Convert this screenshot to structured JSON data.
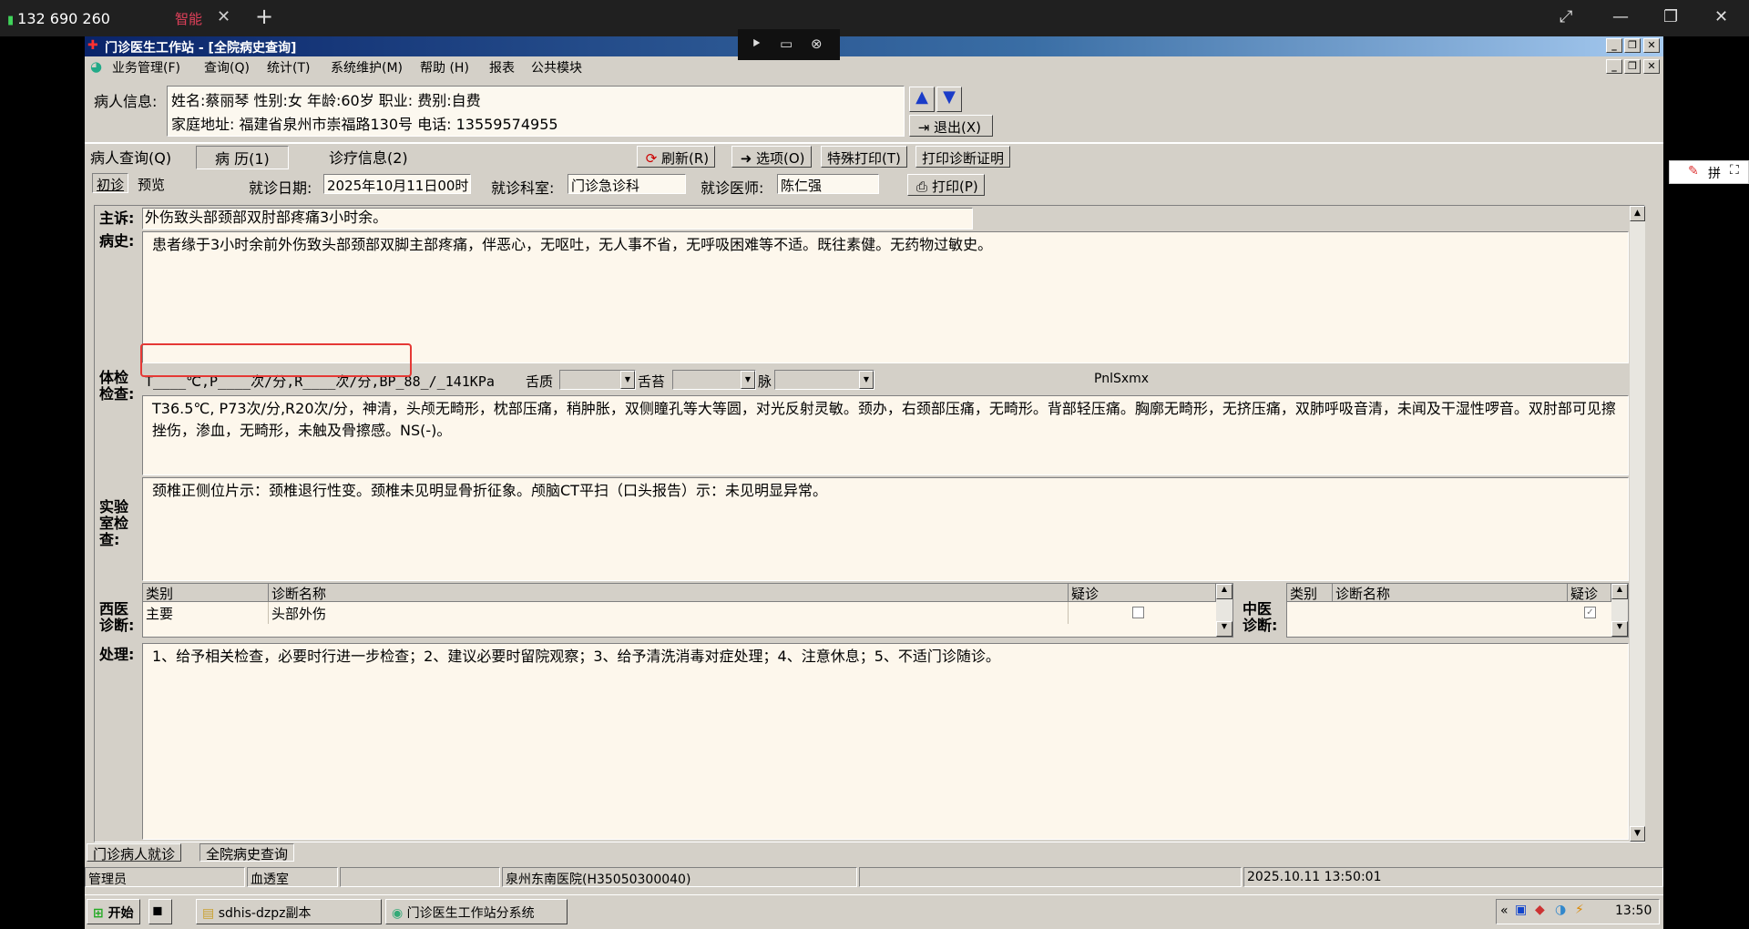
{
  "remote_bar": {
    "connection": "132 690 260",
    "tab_label": "智能",
    "tab_close": "✕",
    "new_tab": "+",
    "expand": "⤢",
    "minimize": "—",
    "restore": "❐",
    "close": "✕"
  },
  "window": {
    "title": "门诊医生工作站 - [全院病史查询]"
  },
  "menu": [
    "业务管理(F)",
    "查询(Q)",
    "统计(T)",
    "系统维护(M)",
    "帮助 (H)",
    "报表",
    "公共模块"
  ],
  "patient": {
    "label": "病人信息:",
    "line1": "姓名:蔡丽琴 性别:女 年龄:60岁   职业: 费别:自费",
    "line2": "家庭地址: 福建省泉州市崇福路130号 电话: 13559574955",
    "exit_label": "退出(X)"
  },
  "tabs": [
    {
      "label": "病人查询(Q)"
    },
    {
      "label": "病 历(1)"
    },
    {
      "label": "诊疗信息(2)"
    }
  ],
  "toolbar": {
    "refresh": "刷新(R)",
    "options": "选项(O)",
    "special_print": "特殊打印(T)",
    "print_cert": "打印诊断证明",
    "print": "打印(P)"
  },
  "visit": {
    "first_visit": "初诊",
    "preview": "预览",
    "date_label": "就诊日期:",
    "date_value": "2025年10月11日00时",
    "dept_label": "就诊科室:",
    "dept_value": "门诊急诊科",
    "doctor_label": "就诊医师:",
    "doctor_value": "陈仁强"
  },
  "record": {
    "complaint_label": "主诉:",
    "complaint": "外伤致头部颈部双肘部疼痛3小时余。",
    "history_label": "病史:",
    "history": "患者缘于3小时余前外伤致头部颈部双脚主部疼痛，伴恶心，无呕吐，无人事不省，无呼吸困难等不适。既往素健。无药物过敏史。",
    "exam_label": "体检检查:",
    "vitals_template": "T____℃,P____次/分,R____次/分,BP_88_/_141KPa",
    "tongue_label": "舌质",
    "coating_label": "舌苔",
    "pulse_label": "脉",
    "pnl_label": "PnlSxmx",
    "exam": "T36.5℃, P73次/分,R20次/分，神清，头颅无畸形，枕部压痛，稍肿胀，双侧瞳孔等大等圆，对光反射灵敏。颈办，右颈部压痛，无畸形。背部轻压痛。胸廓无畸形，无挤压痛，双肺呼吸音清，未闻及干湿性啰音。双肘部可见擦挫伤，渗血，无畸形，未触及骨擦感。NS(-)。",
    "lab_label": "实验室检查:",
    "lab": "颈椎正侧位片示：颈椎退行性变。颈椎未见明显骨折征象。颅脑CT平扫（口头报告）示：未见明显异常。",
    "western_label": "西医诊断:",
    "western_headers": [
      "类别",
      "诊断名称",
      "疑诊"
    ],
    "western_rows": [
      {
        "type": "主要",
        "name": "头部外伤"
      }
    ],
    "tcm_label": "中医诊断:",
    "tcm_headers": [
      "类别",
      "诊断名称",
      "疑诊"
    ],
    "treatment_label": "处理:",
    "treatment": "1、给予相关检查，必要时行进一步检查；2、建议必要时留院观察；3、给予清洗消毒对症处理；4、注意休息；5、不适门诊随诊。"
  },
  "bottom_tabs": [
    "门诊病人就诊",
    "全院病史查询"
  ],
  "status": {
    "user": "管理员",
    "dept": "血透室",
    "hospital": "泉州东南医院(H35050300040)",
    "datetime": "2025.10.11 13:50:01"
  },
  "taskbar": {
    "start": "开始",
    "item1": "sdhis-dzpz副本",
    "item2": "门诊医生工作站分系统",
    "clock": "13:50",
    "chevron": "«"
  },
  "ime": {
    "lang": "拼"
  },
  "colors": {
    "title_start": "#0a246a",
    "title_end": "#a6caf0",
    "field_bg": "#fdf7ec",
    "highlight": "#e53935"
  }
}
